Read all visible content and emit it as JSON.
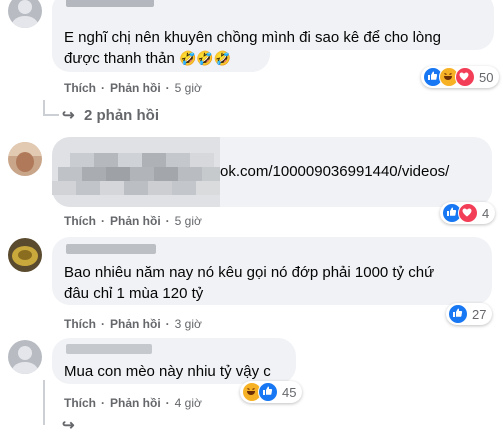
{
  "comments": [
    {
      "text": "E nghĩ chị nên khuyên chồng mình đi sao kê để cho lòng",
      "text2": "được thanh thản",
      "emojis": "🤣🤣🤣",
      "like_label": "Thích",
      "reply_label": "Phản hồi",
      "time": "5 giờ",
      "reaction_count": "50",
      "replies_label": "2 phản hồi"
    },
    {
      "text": "ok.com/100009036991440/videos/",
      "like_label": "Thích",
      "reply_label": "Phản hồi",
      "time": "5 giờ",
      "reaction_count": "4"
    },
    {
      "text": "Bao nhiêu năm nay nó kêu gọi nó đớp phải 1000 tỷ chứ",
      "text2": "đâu chỉ 1 mùa 120 tỷ",
      "like_label": "Thích",
      "reply_label": "Phản hồi",
      "time": "3 giờ",
      "reaction_count": "27"
    },
    {
      "text": "Mua con mèo này nhiu tỷ vậy c",
      "like_label": "Thích",
      "reply_label": "Phản hồi",
      "time": "4 giờ",
      "reaction_count": "45"
    }
  ],
  "colors": {
    "like": "#1877f2",
    "love": "#f33e58",
    "haha": "#f7b125",
    "muted": "#65676b",
    "bubble": "#f0f2f5"
  }
}
